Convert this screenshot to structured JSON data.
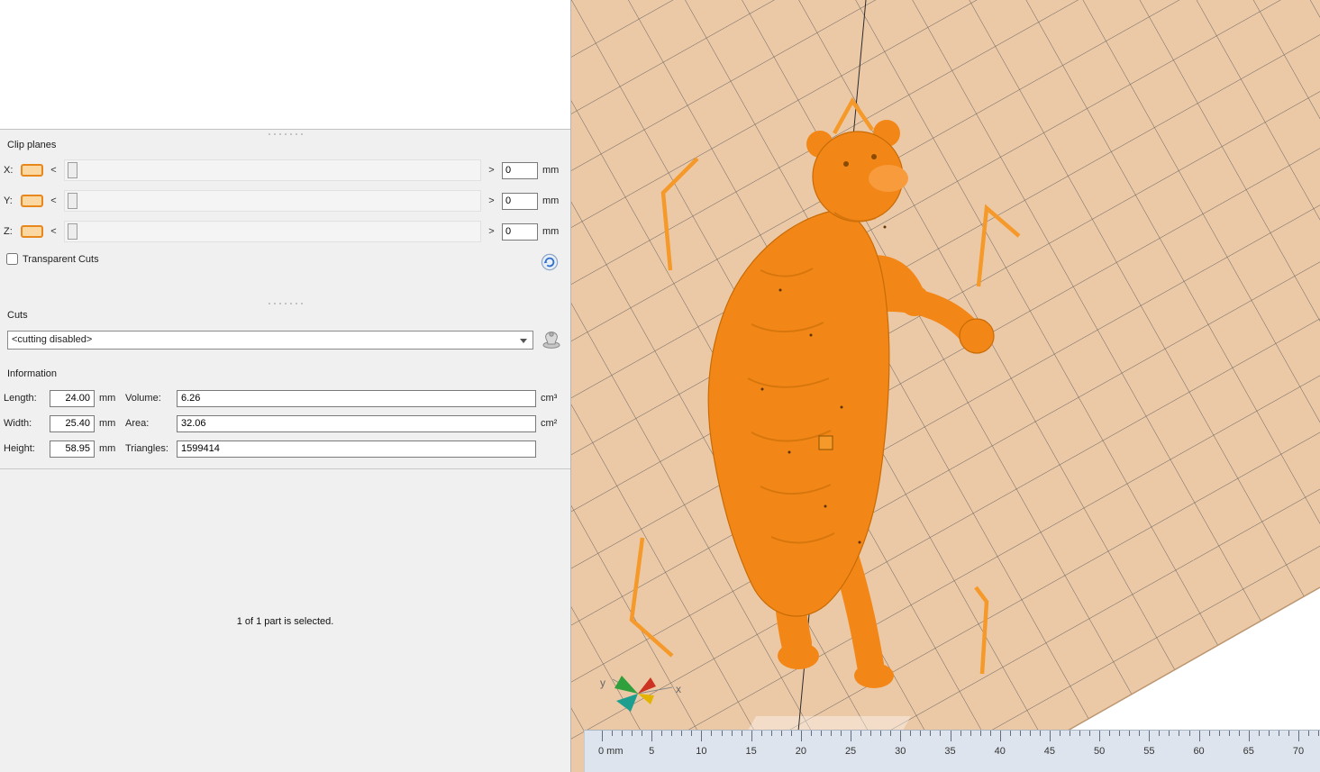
{
  "clip_planes": {
    "title": "Clip planes",
    "transparent_cuts": "Transparent Cuts",
    "left_arrow": "<",
    "right_arrow": ">",
    "axes": [
      {
        "label": "X:",
        "value": "0",
        "unit": "mm"
      },
      {
        "label": "Y:",
        "value": "0",
        "unit": "mm"
      },
      {
        "label": "Z:",
        "value": "0",
        "unit": "mm"
      }
    ]
  },
  "cuts": {
    "title": "Cuts",
    "selected": "<cutting disabled>"
  },
  "information": {
    "title": "Information",
    "rows": [
      {
        "l_label": "Length:",
        "l_value": "24.00",
        "l_unit": "mm",
        "r_label": "Volume:",
        "r_value": "6.26",
        "r_unit": "cm³"
      },
      {
        "l_label": "Width:",
        "l_value": "25.40",
        "l_unit": "mm",
        "r_label": "Area:",
        "r_value": "32.06",
        "r_unit": "cm²"
      },
      {
        "l_label": "Height:",
        "l_value": "58.95",
        "l_unit": "mm",
        "r_label": "Triangles:",
        "r_value": "1599414",
        "r_unit": ""
      }
    ]
  },
  "status": "1 of 1 part is selected.",
  "viewport": {
    "ruler": {
      "labels": [
        "0 mm",
        "5",
        "10",
        "15",
        "20",
        "25",
        "30",
        "35",
        "40",
        "45",
        "50",
        "55",
        "60",
        "65",
        "70"
      ]
    },
    "gizmo": {
      "x": "x",
      "y": "y"
    },
    "colors": {
      "platform": "#ecc9a6",
      "grid": "#555555",
      "model": "#f28718",
      "marker": "#f59a2a"
    }
  }
}
